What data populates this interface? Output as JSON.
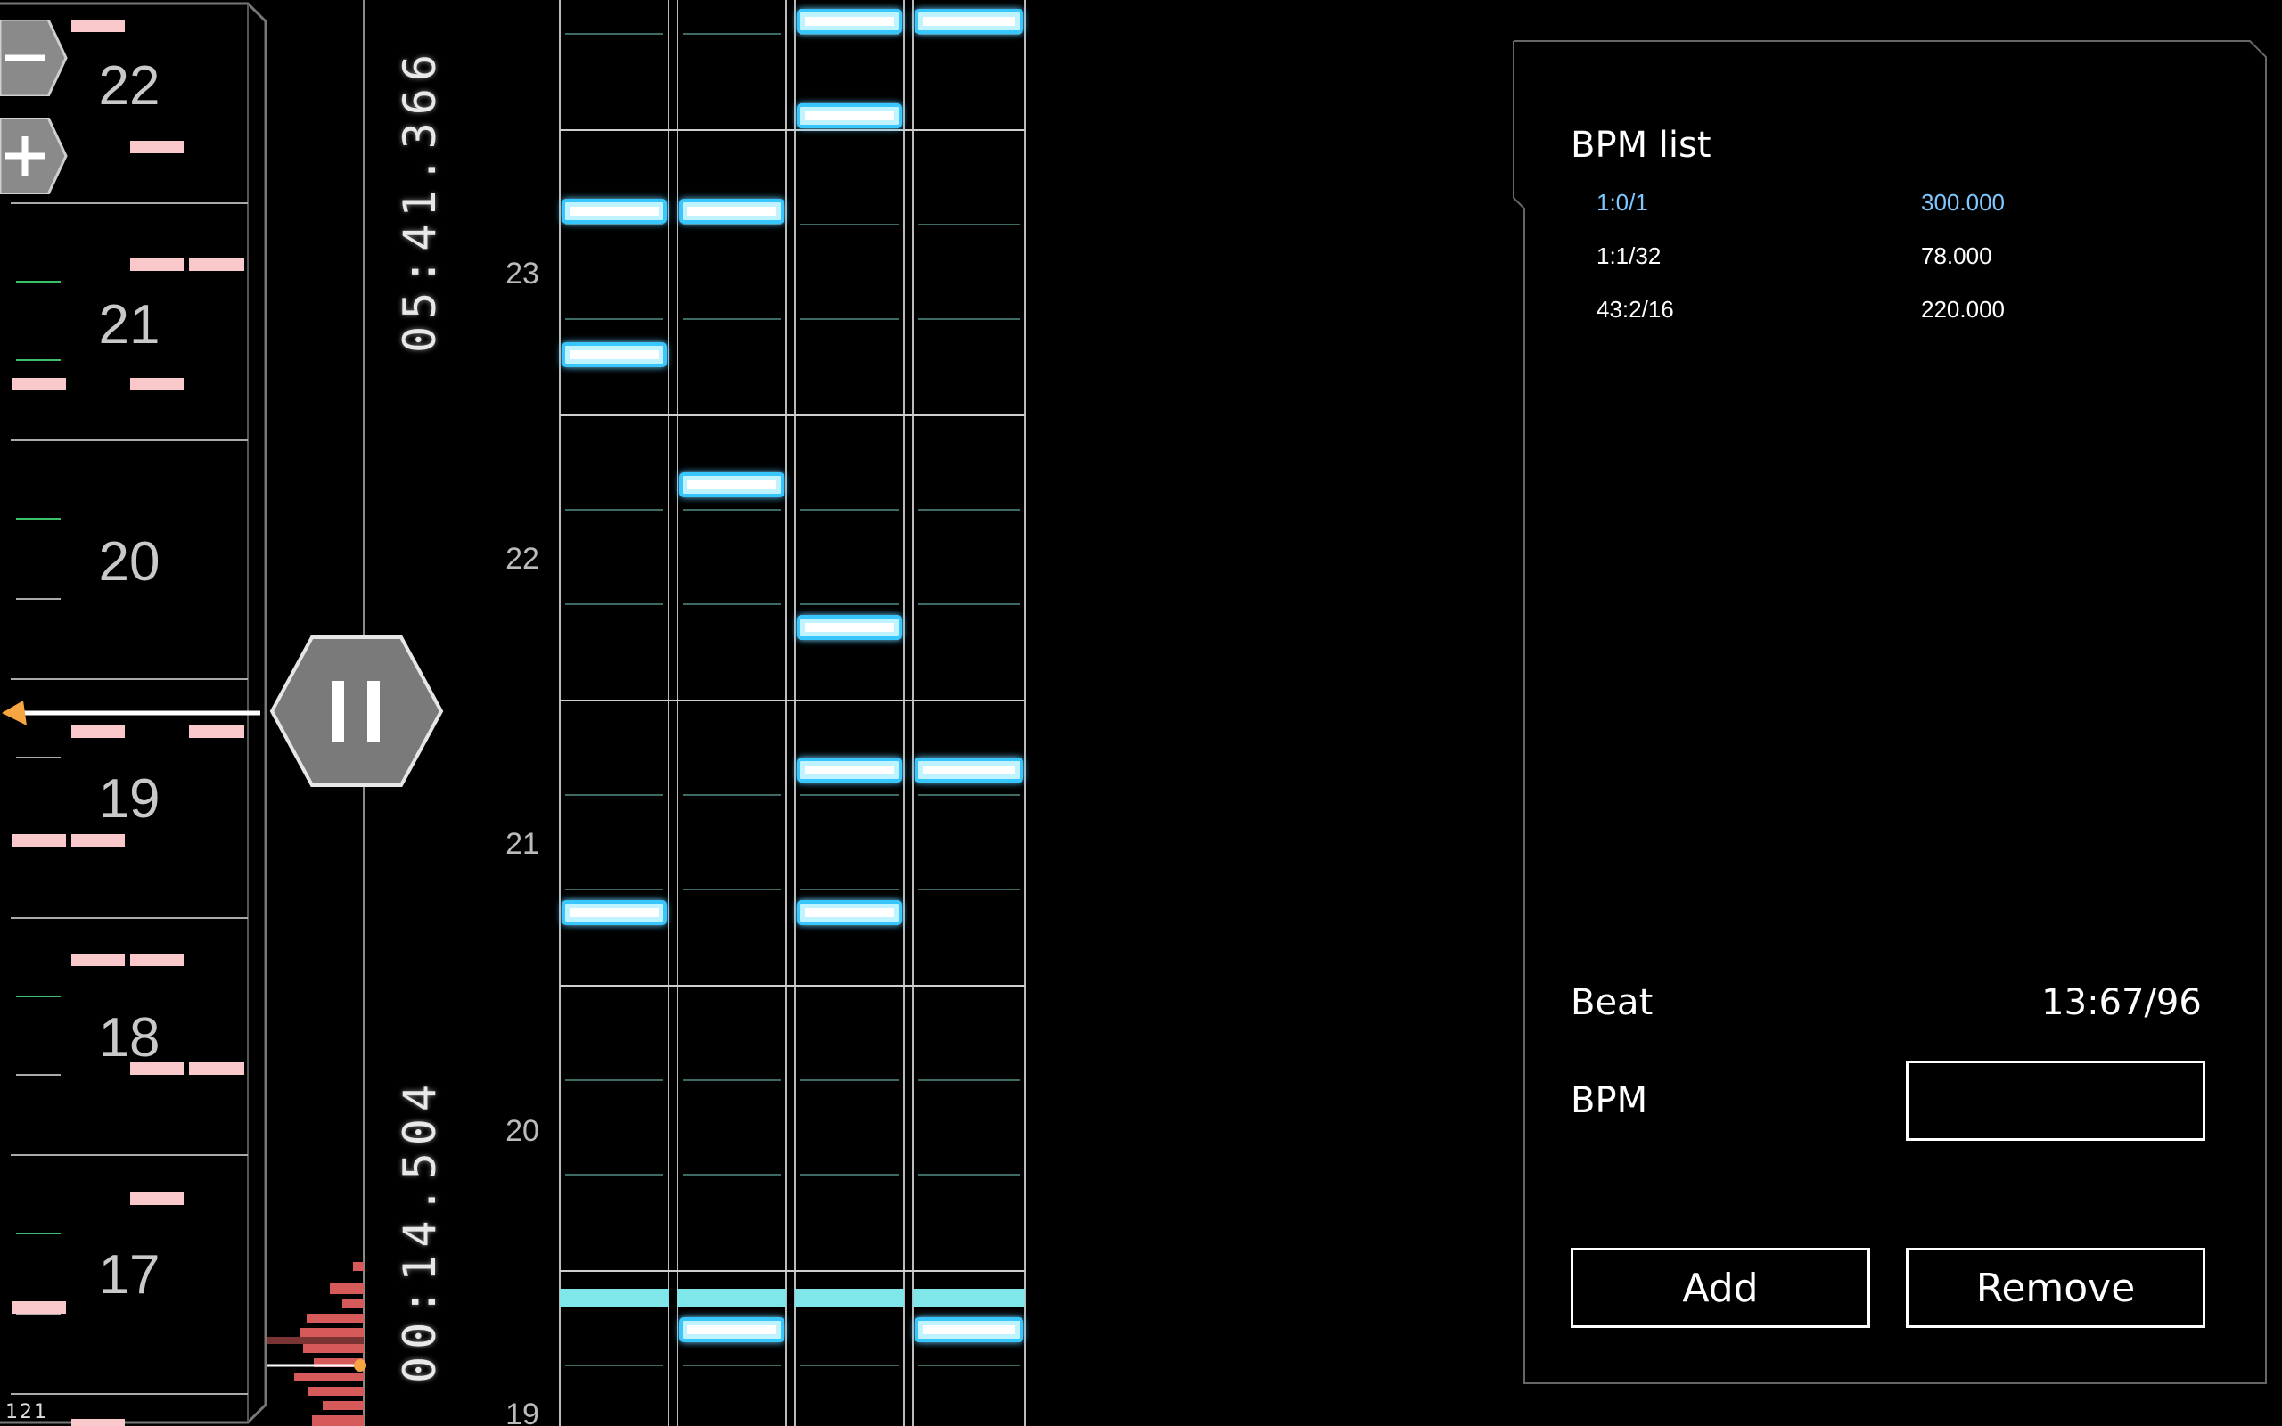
{
  "timeline": {
    "measure_labels": [
      "22",
      "21",
      "20",
      "19",
      "18",
      "17"
    ],
    "bottom_counter": "121",
    "time_top": "05:41.366",
    "time_bottom": "00:14.504",
    "zoom_out_icon": "minus-icon",
    "zoom_in_icon": "plus-icon",
    "pause_icon": "pause-icon"
  },
  "lanes": {
    "measure_labels": [
      "23",
      "22",
      "21",
      "20",
      "19"
    ]
  },
  "bpm_panel": {
    "title": "BPM list",
    "entries": [
      {
        "beat": "1:0/1",
        "bpm": "300.000",
        "selected": true
      },
      {
        "beat": "1:1/32",
        "bpm": "78.000",
        "selected": false
      },
      {
        "beat": "43:2/16",
        "bpm": "220.000",
        "selected": false
      }
    ],
    "beat_label": "Beat",
    "beat_value": "13:67/96",
    "bpm_label": "BPM",
    "bpm_input_value": "",
    "add_label": "Add",
    "remove_label": "Remove"
  },
  "colors": {
    "note_pink": "#f8c8ca",
    "note_blue": "#bff3ff",
    "note_glow": "#39c6ff",
    "cursor_line": "#7fe6ea",
    "selected_entry": "#7ec8ff",
    "marker_orange": "#f5a542",
    "histogram": "#d65a5a"
  }
}
